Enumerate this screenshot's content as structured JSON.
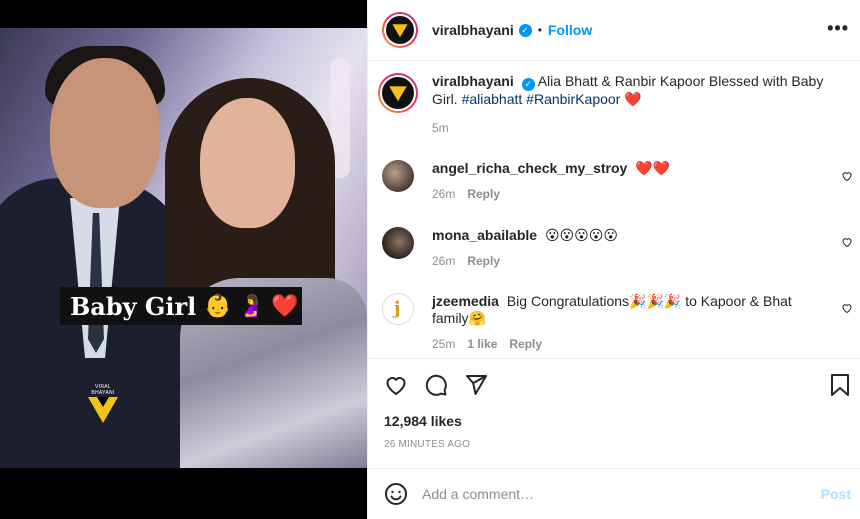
{
  "media": {
    "sticker_text": "Baby Girl",
    "sticker_emojis": "👶 🤰 ❤️",
    "watermark_text": "VIRAL BHAYANI"
  },
  "header": {
    "username": "viralbhayani",
    "verified": true,
    "dot": "•",
    "follow_label": "Follow",
    "more_label": "•••"
  },
  "caption": {
    "username": "viralbhayani",
    "text": "Alia Bhatt & Ranbir Kapoor Blessed with Baby Girl.",
    "hashtags": "#aliabhatt #RanbirKapoor",
    "emoji": "❤️",
    "time": "5m"
  },
  "comments": [
    {
      "username": "angel_richa_check_my_stroy",
      "text": "❤️❤️",
      "time": "26m",
      "likes": "",
      "reply": "Reply"
    },
    {
      "username": "mona_abailable",
      "text": "😮😮😮😮😮",
      "time": "26m",
      "likes": "",
      "reply": "Reply"
    },
    {
      "username": "jzeemedia",
      "text": "Big Congratulations🎉🎉🎉 to Kapoor & Bhat family🤗",
      "time": "25m",
      "likes": "1 like",
      "reply": "Reply"
    }
  ],
  "actions": {
    "likes": "12,984 likes",
    "timestamp": "26 MINUTES AGO"
  },
  "add_comment": {
    "placeholder": "Add a comment…",
    "post_label": "Post"
  },
  "colors": {
    "accent": "#0095f6",
    "post_disabled": "#b2dffc",
    "muted": "#8e8e8e",
    "hashtag": "#00376b",
    "brand_yellow": "#f2c21c"
  }
}
